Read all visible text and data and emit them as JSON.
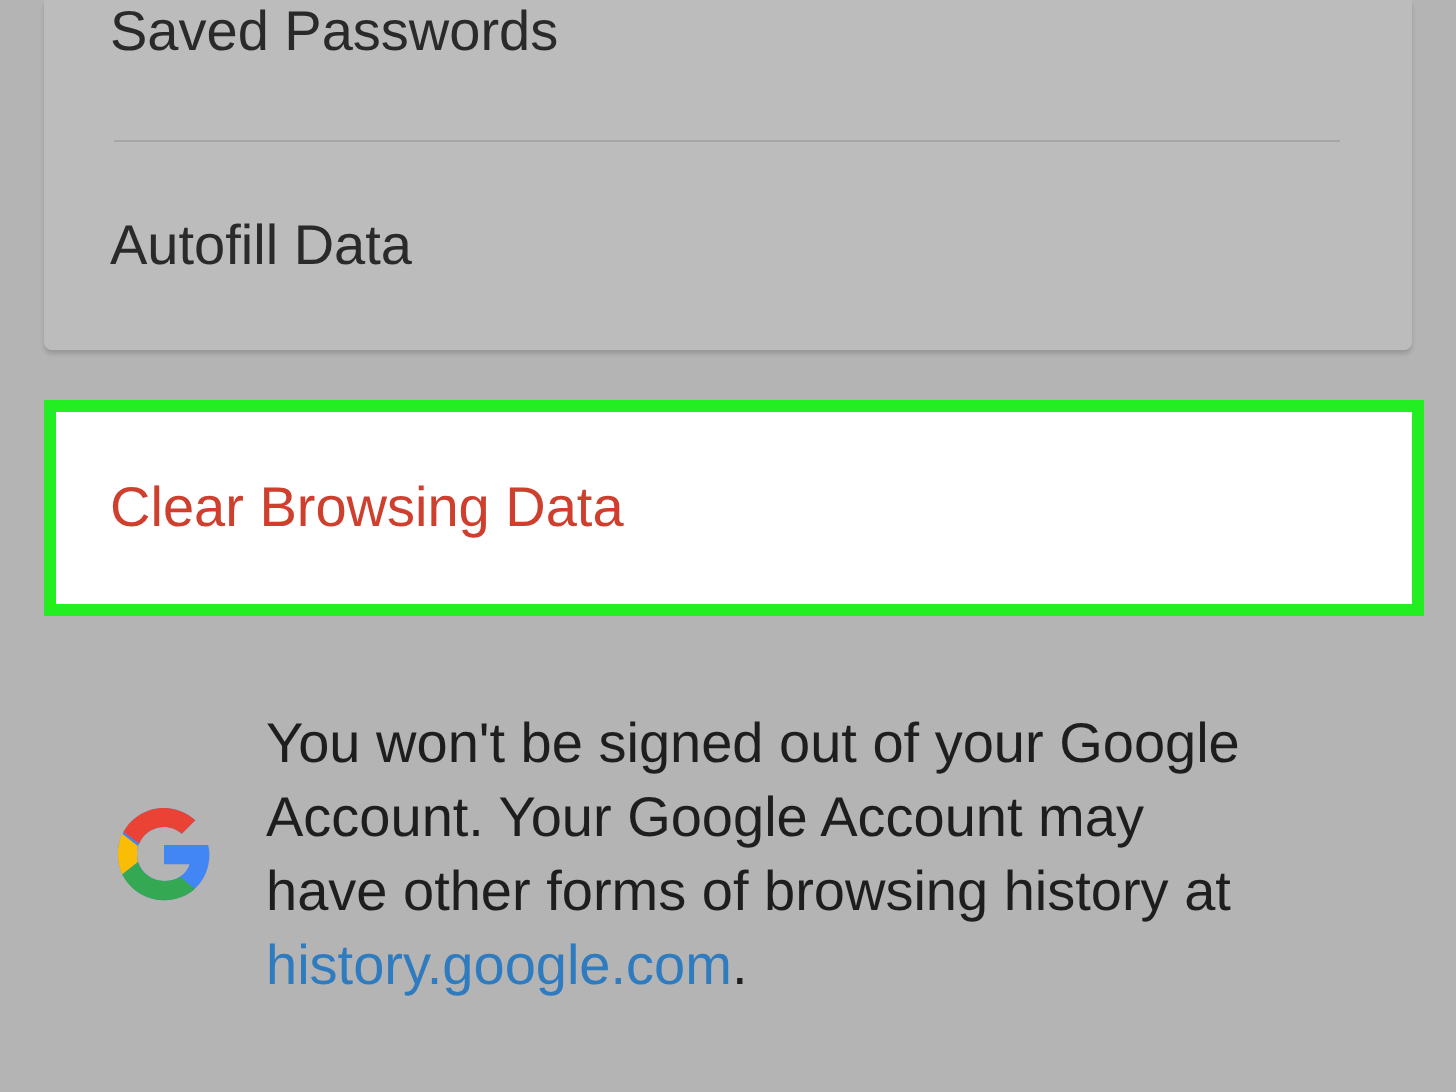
{
  "settings_list": [
    {
      "label": "Saved Passwords"
    },
    {
      "label": "Autofill Data"
    }
  ],
  "highlighted_action": {
    "label": "Clear Browsing Data",
    "selected": true
  },
  "notice": {
    "text": "You won't be signed out of your Google Account. Your Google Account may have other forms of browsing history at ",
    "link": "history.google.com",
    "trailing": "."
  }
}
